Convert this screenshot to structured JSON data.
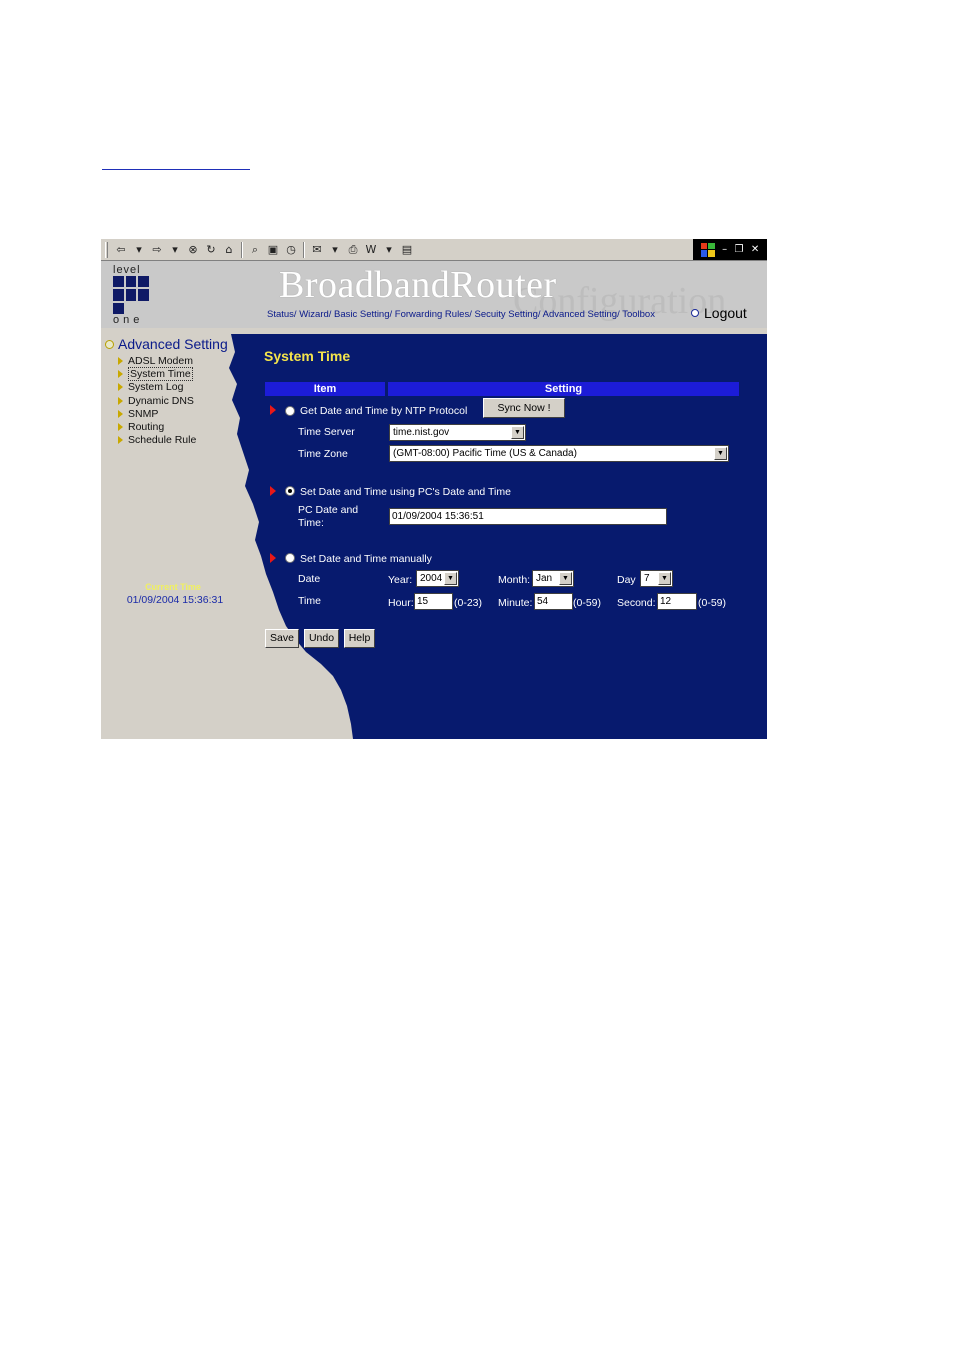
{
  "header": {
    "brand_title": "BroadbandRouter",
    "brand_subtitle": "Configuration",
    "nav_links": "Status/ Wizard/ Basic Setting/ Forwarding Rules/ Secuity Setting/ Advanced Setting/ Toolbox",
    "logout_label": "Logout",
    "logo_top": "level",
    "logo_bottom": "one"
  },
  "toolbar": {
    "back": "⇦",
    "forward": "⇨",
    "stop": "⊗",
    "refresh": "↻",
    "home": "⌂",
    "search": "⌕",
    "favorites": "▣",
    "history": "◷",
    "mail": "✉",
    "print": "⎙",
    "edit": "W",
    "discuss": "▤",
    "min": "–",
    "restore": "❐",
    "close": "✕"
  },
  "sidebar": {
    "title": "Advanced Setting",
    "items": [
      "ADSL Modem",
      "System Time",
      "System Log",
      "Dynamic DNS",
      "SNMP",
      "Routing",
      "Schedule Rule"
    ],
    "current_time_label": "Current Time",
    "current_time_value": "01/09/2004 15:36:31"
  },
  "main": {
    "title": "System Time",
    "col_item": "Item",
    "col_setting": "Setting",
    "ntp": {
      "label": "Get Date and Time by NTP Protocol",
      "sync_button": "Sync Now !",
      "time_server_label": "Time Server",
      "time_server_value": "time.nist.gov",
      "time_zone_label": "Time Zone",
      "time_zone_value": "(GMT-08:00) Pacific Time (US & Canada)"
    },
    "pc": {
      "label": "Set Date and Time using PC's Date and Time",
      "pc_date_label_1": "PC Date and",
      "pc_date_label_2": "Time:",
      "pc_date_value": "01/09/2004 15:36:51"
    },
    "manual": {
      "label": "Set Date and Time manually",
      "date_label": "Date",
      "time_label": "Time",
      "year_label": "Year:",
      "year_value": "2004",
      "month_label": "Month:",
      "month_value": "Jan",
      "day_label": "Day",
      "day_value": "7",
      "hour_label": "Hour:",
      "hour_value": "15",
      "hour_range": "(0-23)",
      "minute_label": "Minute:",
      "minute_value": "54",
      "minute_range": "(0-59)",
      "second_label": "Second:",
      "second_value": "12",
      "second_range": "(0-59)"
    },
    "buttons": {
      "save": "Save",
      "undo": "Undo",
      "help": "Help"
    },
    "selected_mode": "pc"
  },
  "colors": {
    "content_bg": "#071a6e",
    "header_bar": "#1c1cd8",
    "title_yellow": "#f4e44c"
  }
}
